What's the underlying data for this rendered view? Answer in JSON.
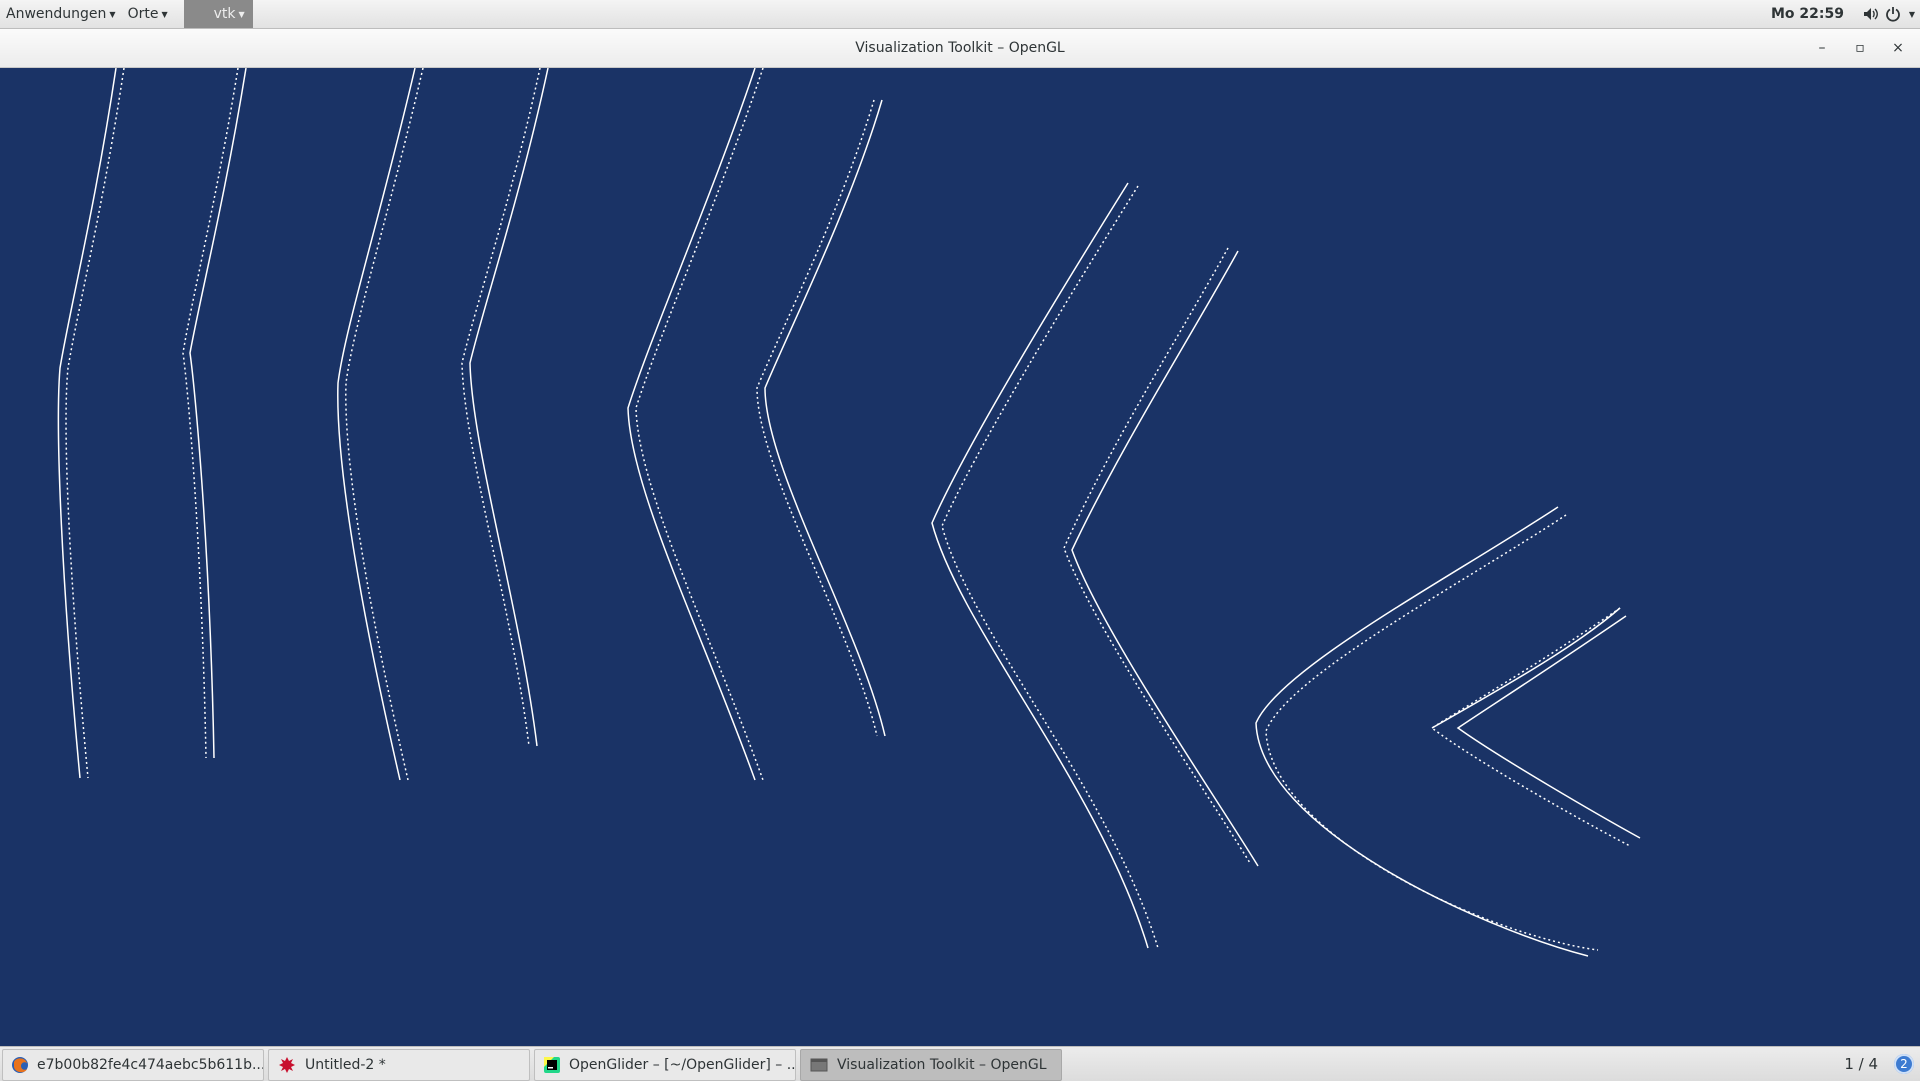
{
  "top_bar": {
    "applications_label": "Anwendungen",
    "places_label": "Orte",
    "app_menu_label": "vtk",
    "clock": "Mo 22:59"
  },
  "window": {
    "title": "Visualization Toolkit – OpenGL",
    "minimize_glyph": "–",
    "maximize_glyph": "▫",
    "close_glyph": "×"
  },
  "taskbar": {
    "tasks": [
      {
        "label": "e7b00b82fe4c474aebc5b611b...",
        "icon": "firefox-icon",
        "active": false
      },
      {
        "label": "Untitled-2 *",
        "icon": "inkscape-icon",
        "active": false
      },
      {
        "label": "OpenGlider – [~/OpenGlider] – .../...",
        "icon": "pycharm-icon",
        "active": false
      },
      {
        "label": "Visualization Toolkit – OpenGL",
        "icon": "window-icon",
        "active": true
      }
    ],
    "workspace": "1 / 4",
    "notification_count": "2"
  },
  "colors": {
    "background": "#1a3366",
    "curve": "#ffffff"
  }
}
